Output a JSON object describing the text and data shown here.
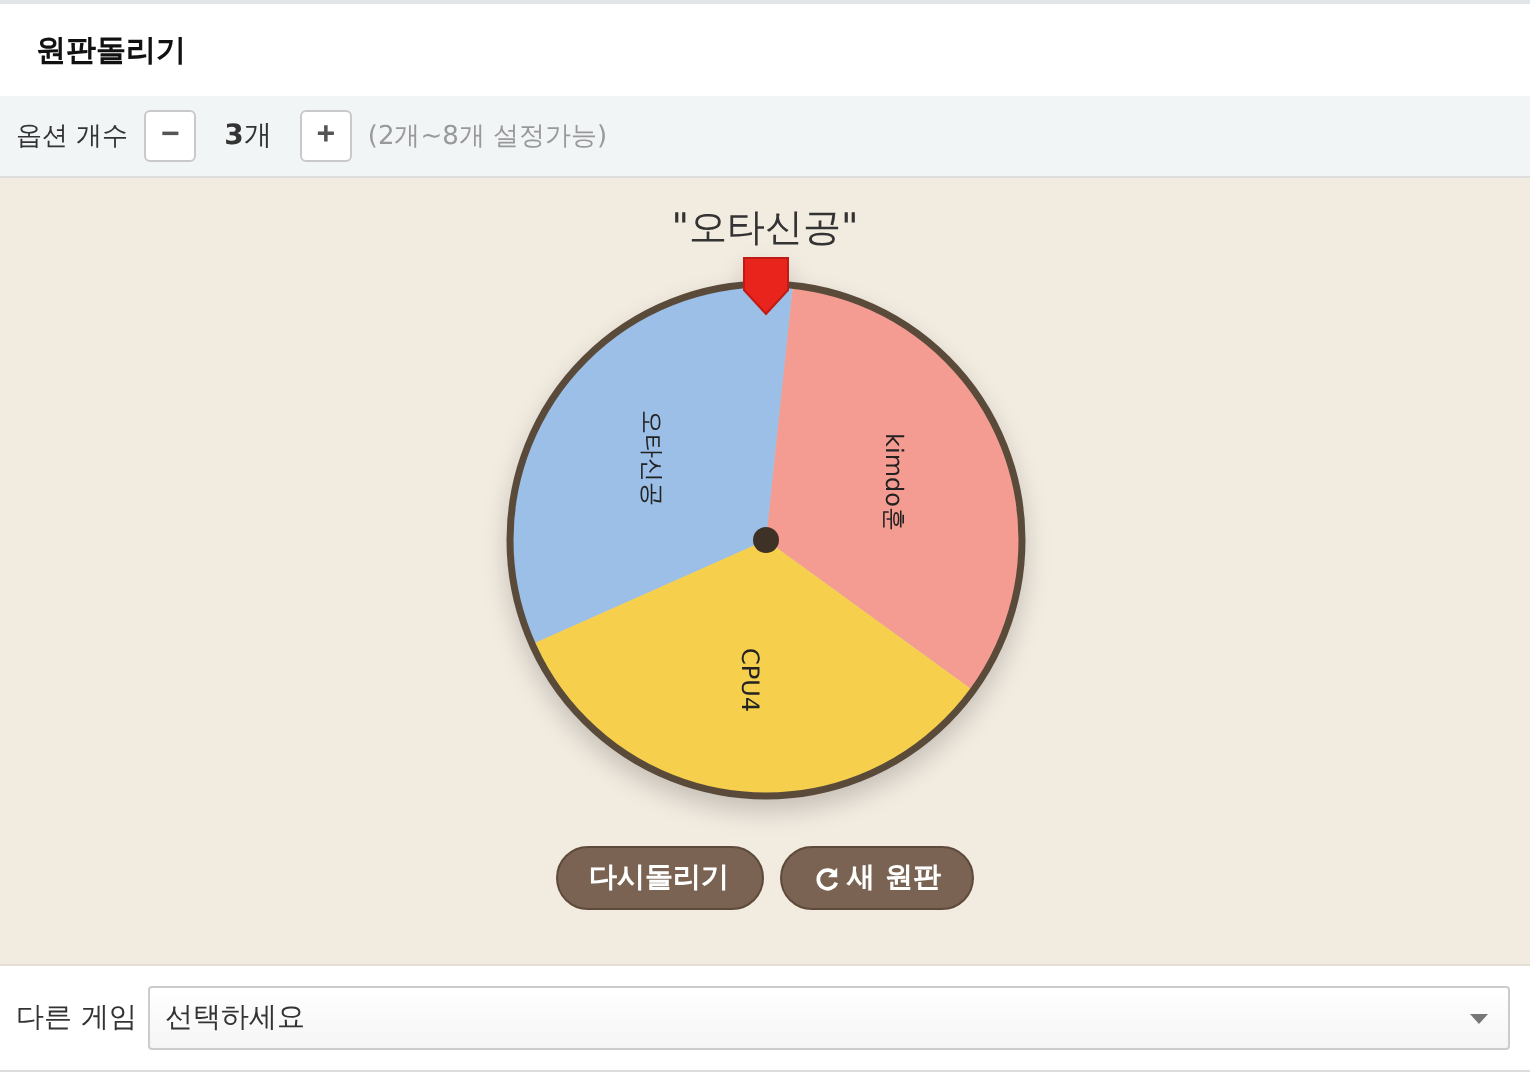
{
  "header": {
    "title": "원판돌리기"
  },
  "options": {
    "label": "옵션 개수",
    "minus": "−",
    "count": "3",
    "count_unit": "개",
    "plus": "+",
    "hint": "(2개~8개 설정가능)"
  },
  "result": {
    "title": "\"오타신공\""
  },
  "wheel": {
    "segments": [
      {
        "label": "kimdo훈",
        "color": "#f59c92"
      },
      {
        "label": "CPU4",
        "color": "#f6d04d"
      },
      {
        "label": "오타신공",
        "color": "#9bbfe6"
      }
    ]
  },
  "buttons": [
    {
      "kind": "spin",
      "label": "다시돌리기"
    },
    {
      "kind": "new",
      "label": "새 원판"
    }
  ],
  "other_game": {
    "label": "다른 게임",
    "placeholder": "선택하세요"
  }
}
